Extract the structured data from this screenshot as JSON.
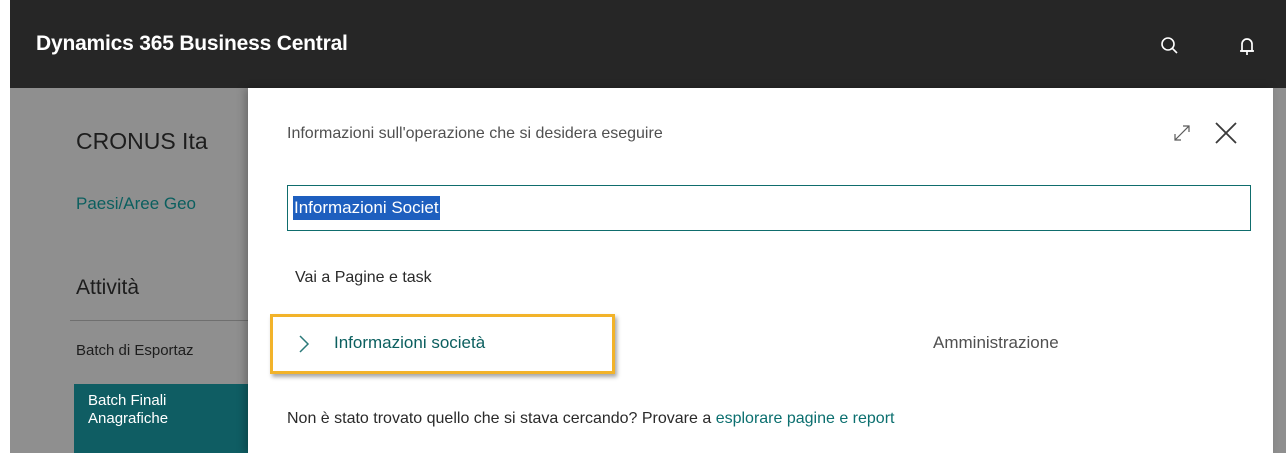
{
  "topbar": {
    "title": "Dynamics 365 Business Central",
    "icons": [
      "search-icon",
      "bell-icon"
    ]
  },
  "background_page": {
    "company_name": "CRONUS Ita",
    "link": "Paesi/Aree Geo",
    "section_title": "Attività",
    "group_label": "Batch di Esportaz",
    "tile_label": "Batch Finali Anagrafiche"
  },
  "dialog": {
    "prompt": "Informazioni sull'operazione che si desidera eseguire",
    "search_value": "Informazioni Societ",
    "results_heading": "Vai a Pagine e task",
    "results": [
      {
        "label": "Informazioni società",
        "category": "Amministrazione"
      }
    ],
    "footer_text": "Non è stato trovato quello che si stava cercando? Provare a ",
    "footer_link": "esplorare pagine e report",
    "icons": [
      "expand-icon",
      "close-icon",
      "chevron-right-icon"
    ]
  },
  "colors": {
    "topbar": "#262626",
    "accent_teal": "#0b5f5f",
    "highlight_border": "#f2b32a",
    "selection": "#1e5fbf"
  }
}
